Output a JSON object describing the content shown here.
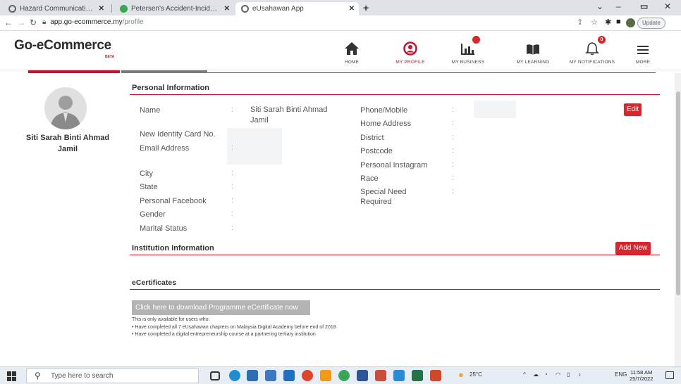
{
  "browser": {
    "tabs": [
      {
        "title": "Hazard Communication Standar",
        "favicon_color": "#5f6368"
      },
      {
        "title": "Petersen's Accident-Incident Ca",
        "favicon_color": "#34a853"
      },
      {
        "title": "eUsahawan App",
        "favicon_color": "#5f6368"
      }
    ],
    "url_host": "app.go-ecommerce.my",
    "url_path": "/profile",
    "update_label": "Update"
  },
  "header": {
    "logo": "Go-eCommerce",
    "beta": "BETA",
    "nav": [
      {
        "label": "HOME",
        "icon": "home-icon"
      },
      {
        "label": "MY PROFILE",
        "icon": "profile-icon"
      },
      {
        "label": "MY BUSINESS",
        "icon": "business-icon",
        "badge": ""
      },
      {
        "label": "MY LEARNING",
        "icon": "learning-icon"
      },
      {
        "label": "MY NOTIFICATIONS",
        "icon": "bell-icon",
        "badge": "0"
      },
      {
        "label": "MORE",
        "icon": "menu-icon"
      }
    ]
  },
  "profile": {
    "name_line1": "Siti Sarah Binti Ahmad",
    "name_line2": "Jamil"
  },
  "personal_info": {
    "title": "Personal Information",
    "edit_label": "Edit",
    "left_fields": [
      {
        "label": "Name",
        "value_line1": "Siti Sarah Binti Ahmad",
        "value_line2": "Jamil"
      },
      {
        "label": "New Identity Card No."
      },
      {
        "label": "Email Address"
      },
      {
        "label": "City"
      },
      {
        "label": "State"
      },
      {
        "label": "Personal Facebook"
      },
      {
        "label": "Gender"
      },
      {
        "label": "Marital Status"
      }
    ],
    "right_fields": [
      {
        "label": "Phone/Mobile"
      },
      {
        "label": "Home Address"
      },
      {
        "label": "District"
      },
      {
        "label": "Postcode"
      },
      {
        "label": "Personal Instagram"
      },
      {
        "label": "Race"
      },
      {
        "label_line1": "Special Need",
        "label_line2": "Required"
      }
    ],
    "colon": ":"
  },
  "institution": {
    "title": "Institution Information",
    "add_label": "Add New"
  },
  "ecertificates": {
    "title": "eCertificates",
    "download_label": "Click here to download Programme eCertificate now",
    "note_intro": "This is only available for users who:",
    "notes": [
      "•  Have completed all 7 eUsahawan chapters on Malaysia Digital Academy before end of 2018",
      "•  Have completed a digital entrepreneurship course at a partnering tertiary institution"
    ]
  },
  "taskbar": {
    "search_placeholder": "Type here to search",
    "weather": "25°C",
    "lang": "ENG",
    "time": "11:58 AM",
    "date": "25/7/2022"
  },
  "colors": {
    "accent": "#c8102e",
    "button_red": "#d9252b"
  }
}
